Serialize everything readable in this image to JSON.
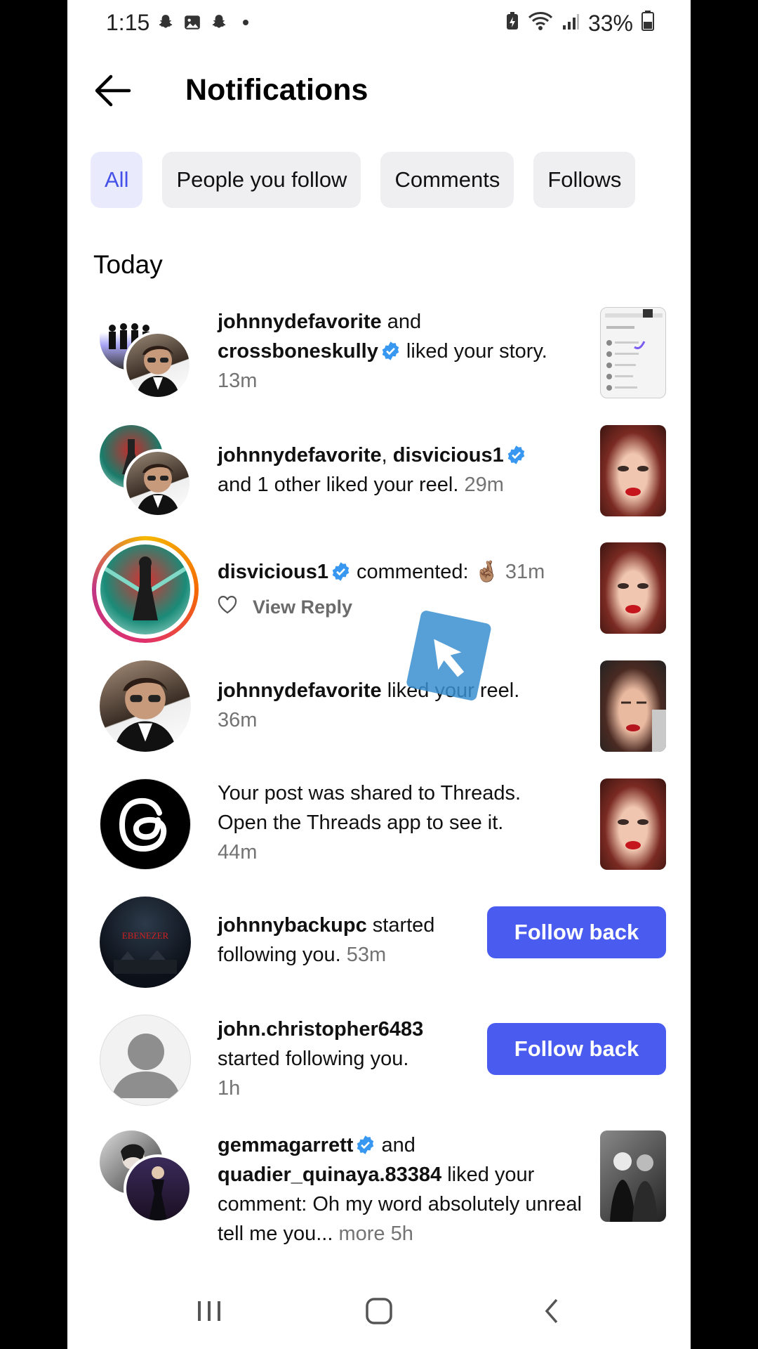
{
  "status": {
    "time": "1:15",
    "battery": "33%",
    "icons": [
      "snapchat-icon",
      "gallery-icon",
      "snapchat-icon",
      "dot-icon"
    ]
  },
  "header": {
    "title": "Notifications"
  },
  "tabs": [
    {
      "label": "All",
      "active": true
    },
    {
      "label": "People you follow",
      "active": false
    },
    {
      "label": "Comments",
      "active": false
    },
    {
      "label": "Follows",
      "active": false
    }
  ],
  "section": {
    "label": "Today"
  },
  "notifications": [
    {
      "user1": "johnnydefavorite",
      "joiner1": " and ",
      "user2": "crossboneskully",
      "text": " liked your story.",
      "time": "13m"
    },
    {
      "user1": "johnnydefavorite",
      "joiner1": ", ",
      "user2": "disvicious1",
      "text": "and 1 other liked your reel.",
      "time": "29m"
    },
    {
      "user1": "disvicious1",
      "text": " commented: 🤞🏽",
      "time": "31m",
      "reply_label": "View Reply"
    },
    {
      "user1": "johnnydefavorite",
      "text": " liked your reel.",
      "time": "36m"
    },
    {
      "text": "Your post was shared to Threads. Open the Threads app to see it.",
      "time": "44m"
    },
    {
      "user1": "johnnybackupc",
      "text": " started following you.",
      "time": "53m",
      "button": "Follow back"
    },
    {
      "user1": "john.christopher6483",
      "text": "started following you.",
      "time": "1h",
      "button": "Follow back"
    },
    {
      "user1": "gemmagarrett",
      "joiner1": " and ",
      "user2": "quadier_quinaya.83384",
      "text": " liked your comment: Oh my word absolutely unreal tell me you...",
      "more": " more",
      "time": "5h"
    }
  ],
  "colors": {
    "accent": "#4a5cf0",
    "active_tab_bg": "#e9ebfd",
    "verified": "#3897f0"
  }
}
